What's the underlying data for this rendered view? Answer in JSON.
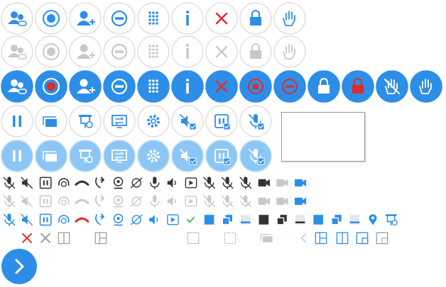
{
  "colors": {
    "blue": "#2d8ee8",
    "lightBlue": "#6fb6f0",
    "grey": "#9e9e9e",
    "lightGrey": "#c8c8c8",
    "dark": "#333333",
    "red": "#e02b2b",
    "green": "#3cb04a",
    "ring": "#e0e0e0"
  },
  "circle_rows": [
    {
      "row": "outline-blue",
      "icons": [
        "participants-icon",
        "record-icon",
        "add-user-icon",
        "stop-icon",
        "keypad-icon",
        "info-icon",
        "close-icon",
        "lock-icon",
        "raise-hand-icon"
      ]
    },
    {
      "row": "outline-grey",
      "icons": [
        "participants-icon",
        "record-icon",
        "add-user-icon",
        "stop-icon",
        "keypad-icon",
        "info-icon",
        "close-icon",
        "lock-icon",
        "raise-hand-icon"
      ]
    },
    {
      "row": "filled-blue",
      "icons": [
        "participants-icon",
        "record-active-icon",
        "add-user-icon",
        "stop-icon",
        "keypad-icon",
        "info-icon",
        "close-icon",
        "stop-record-icon",
        "end-icon",
        "lock-icon",
        "locked-red-icon",
        "lower-hand-icon",
        "raise-hand-icon"
      ]
    },
    {
      "row": "outline-blue-2",
      "icons": [
        "pause-icon",
        "layers-icon",
        "presenter-icon",
        "screenshare-icon",
        "settings-icon",
        "mute-check-icon",
        "pause-check-icon",
        "mic-check-icon"
      ]
    },
    {
      "row": "light-filled",
      "icons": [
        "pause-icon",
        "layers-icon",
        "presenter-icon",
        "screenshare-icon",
        "settings-icon",
        "mute-check-icon",
        "pause-check-icon",
        "mic-check-icon"
      ]
    }
  ],
  "small_rows": [
    {
      "tone": "dark",
      "icons": [
        "mic-off-icon",
        "speaker-off-icon",
        "pause-box-icon",
        "headset-icon",
        "hangup-icon",
        "call-swap-icon",
        "webcam-icon",
        "eye-off-icon",
        "mic-icon",
        "speaker-icon",
        "play-box-icon",
        "mic-disabled-icon",
        "mic-disabled-light-icon",
        "mic-blocked-icon",
        "video-icon",
        "video-pause-icon",
        "video-blue-icon"
      ]
    },
    {
      "tone": "grey",
      "icons": [
        "mic-off-icon",
        "speaker-off-icon",
        "pause-box-icon",
        "headset-icon",
        "hangup-icon",
        "call-swap-icon",
        "webcam-icon",
        "eye-off-icon",
        "mic-icon",
        "speaker-icon",
        "play-box-icon",
        "mic-disabled-icon",
        "mic-disabled-light-icon",
        "mic-blocked-icon",
        "video-icon",
        "video-pause-icon",
        "video-blue-icon"
      ]
    },
    {
      "tone": "blue",
      "icons": [
        "mic-off-icon",
        "speaker-off-icon",
        "pause-box-icon",
        "headset-icon",
        "hangup-red-icon",
        "call-swap-icon",
        "webcam-icon",
        "eye-off-icon",
        "speaker-icon",
        "play-box-icon",
        "checkmark-icon",
        "square-blue-icon",
        "overlap-blue-icon",
        "minimize-blue-icon",
        "square-black-icon",
        "overlap-black-icon",
        "minimize-black-icon",
        "square-blue-2-icon",
        "overlap-blue-2-icon",
        "minimize-blue-2-icon",
        "location-icon",
        "presenter-small-icon"
      ]
    }
  ],
  "misc_row": [
    "close-red-icon",
    "close-grey-icon",
    "split-v-icon",
    "grid-icon",
    "empty-square-icon",
    "dashed-square-icon",
    "stack-icon",
    "chevron-left-icon",
    "layout-a-icon",
    "layout-b-icon",
    "layout-c-icon",
    "layout-d-icon"
  ],
  "tooltip": {
    "text": ""
  },
  "next_button": {
    "icon": "chevron-right-icon"
  }
}
